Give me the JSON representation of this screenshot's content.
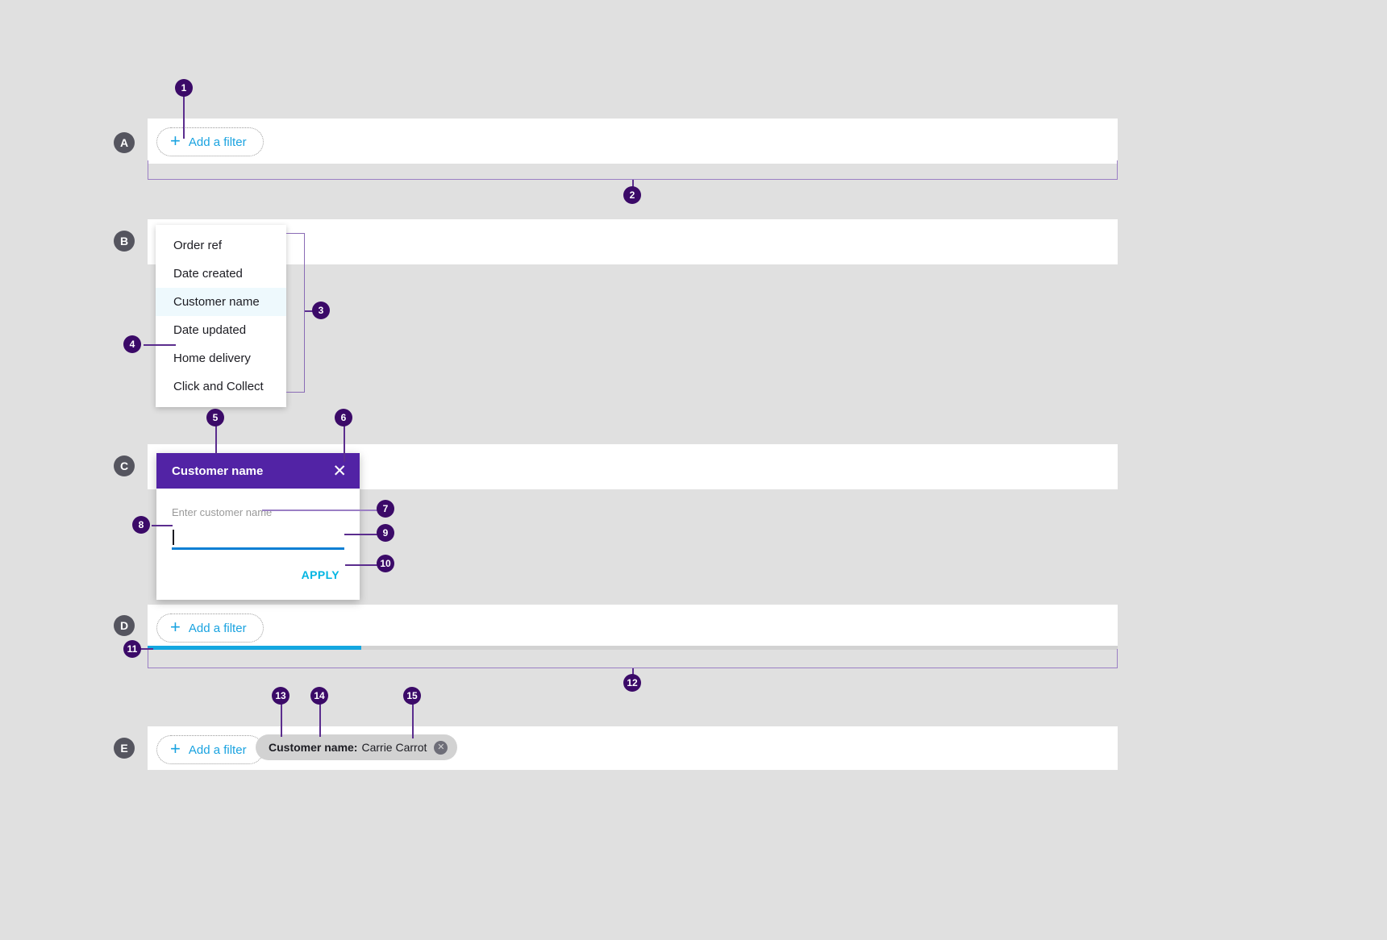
{
  "sections": [
    {
      "letter": "A"
    },
    {
      "letter": "B"
    },
    {
      "letter": "C"
    },
    {
      "letter": "D"
    },
    {
      "letter": "E"
    }
  ],
  "markers": [
    {
      "n": "1"
    },
    {
      "n": "2"
    },
    {
      "n": "3"
    },
    {
      "n": "4"
    },
    {
      "n": "5"
    },
    {
      "n": "6"
    },
    {
      "n": "7"
    },
    {
      "n": "8"
    },
    {
      "n": "9"
    },
    {
      "n": "10"
    },
    {
      "n": "11"
    },
    {
      "n": "12"
    },
    {
      "n": "13"
    },
    {
      "n": "14"
    },
    {
      "n": "15"
    }
  ],
  "add_filter": {
    "label": "Add a filter",
    "plus_icon": "plus-icon",
    "plus_glyph": "+"
  },
  "dropdown": {
    "items": [
      {
        "label": "Order ref",
        "selected": false
      },
      {
        "label": "Date created",
        "selected": false
      },
      {
        "label": "Customer name",
        "selected": true
      },
      {
        "label": "Date updated",
        "selected": false
      },
      {
        "label": "Home delivery",
        "selected": false
      },
      {
        "label": "Click and Collect",
        "selected": false
      }
    ]
  },
  "modal": {
    "title": "Customer name",
    "close_icon": "close-icon",
    "close_glyph": "✕",
    "field_label": "Enter customer name",
    "field_value": "",
    "apply_label": "APPLY"
  },
  "progress": {
    "percent": 22
  },
  "chip": {
    "key": "Customer name:",
    "value": "Carrie Carrot",
    "remove_icon": "chip-remove-icon",
    "remove_glyph": "✕"
  },
  "colors": {
    "background": "#e0e0e0",
    "panel": "#ffffff",
    "accent_blue": "#1aa3e0",
    "modal_purple": "#5223a5",
    "marker_purple": "#3b0a68",
    "leader_purple": "#9b7fc4",
    "apply_cyan": "#00b5e2",
    "progress_blue": "#14a7e0",
    "chip_grey": "#d2d2d2",
    "section_badge_grey": "#55555f",
    "selected_row": "#eef9fd",
    "field_underline": "#0b7fd4"
  }
}
